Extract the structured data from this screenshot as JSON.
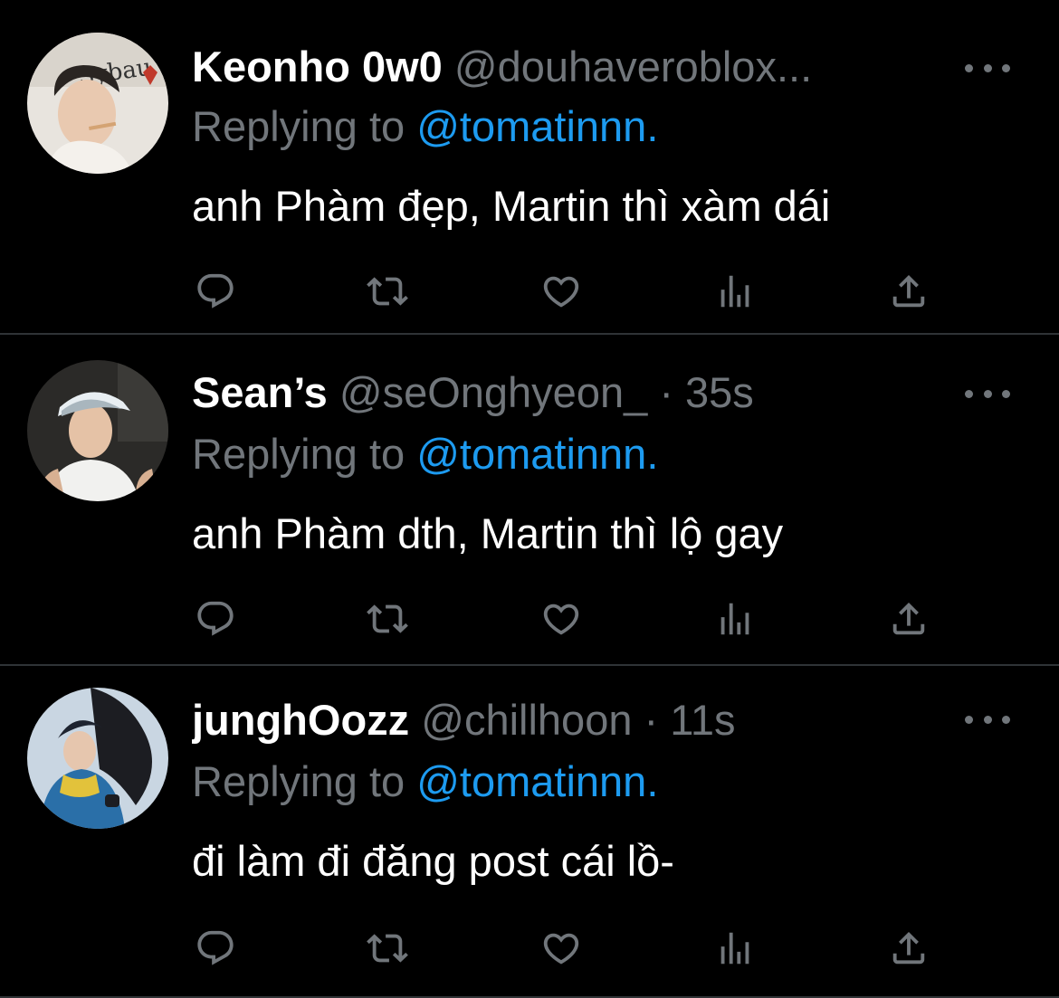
{
  "colors": {
    "background": "#000000",
    "name": "#ffffff",
    "secondary": "#71767b",
    "link": "#1d9bf0",
    "divider": "#2f3336"
  },
  "replying_prefix": "Replying to",
  "tweets": [
    {
      "display_name": "Keonho 0w0",
      "handle": "@douhaveroblox...",
      "separator": "",
      "time": "",
      "reply_to": "@tomatinnn.",
      "text": "anh Phàm đẹp, Martin thì xàm dái",
      "avatar_text": "Sybau"
    },
    {
      "display_name": "Sean’s",
      "handle": "@seOnghyeon_",
      "separator": "·",
      "time": "35s",
      "reply_to": "@tomatinnn.",
      "text": "anh Phàm dth, Martin thì lộ gay"
    },
    {
      "display_name": "junghOozz",
      "handle": "@chillhoon",
      "separator": "·",
      "time": "11s",
      "reply_to": "@tomatinnn.",
      "text": "đi làm đi đăng post cái lồ-"
    }
  ],
  "action_icons": [
    "reply-icon",
    "retweet-icon",
    "like-icon",
    "views-icon",
    "share-icon"
  ]
}
